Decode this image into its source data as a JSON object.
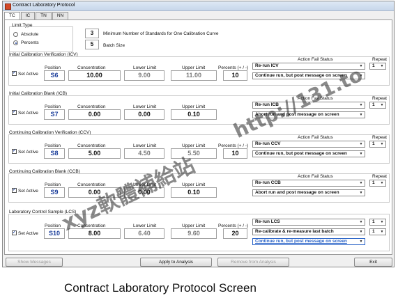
{
  "window": {
    "title": "Contract Laboratory Protocol"
  },
  "tabs": [
    "TC",
    "IC",
    "TN",
    "NN"
  ],
  "limit_type": {
    "label": "Limit Type",
    "options": [
      "Absolute",
      "Percents"
    ],
    "selected": "Percents"
  },
  "settings": [
    {
      "value": "3",
      "label": "Minimum Number of Standards for One Calibration Curve"
    },
    {
      "value": "5",
      "label": "Batch Size"
    }
  ],
  "col_labels": {
    "set_active": "Set Active",
    "position": "Position",
    "concentration": "Concentration",
    "lower": "Lower Limit",
    "upper": "Upper Limit",
    "percents": "Percents (+ / -)",
    "action": "Action Fail Status",
    "repeat": "Repeat"
  },
  "sections": [
    {
      "title": "Initial Calibration Verification (ICV)",
      "position": "S6",
      "concentration": "10.00",
      "lower": "9.00",
      "upper": "11.00",
      "percents": "10",
      "actions": [
        "Re-run ICV",
        "Continue run, but post message on screen"
      ],
      "repeat": "1"
    },
    {
      "title": "Initial Calibration Blank (ICB)",
      "position": "S7",
      "concentration": "0.00",
      "lower": "0.00",
      "upper": "0.10",
      "percents": "",
      "actions": [
        "Re-run ICB",
        "Abort run and post message on screen"
      ],
      "repeat": "1"
    },
    {
      "title": "Continuing Calibration Verification (CCV)",
      "position": "S8",
      "concentration": "5.00",
      "lower": "4.50",
      "upper": "5.50",
      "percents": "10",
      "actions": [
        "Re-run CCV",
        "Continue run, but post message on screen"
      ],
      "repeat": "1"
    },
    {
      "title": "Continuing Calibration Blank (CCB)",
      "position": "S9",
      "concentration": "0.00",
      "lower": "0.00",
      "upper": "0.10",
      "percents": "",
      "actions": [
        "Re-run CCB",
        "Abort run and post message on screen"
      ],
      "repeat": "1"
    },
    {
      "title": "Laboratory Control Sample (LCS)",
      "position": "S10",
      "concentration": "8.00",
      "lower": "6.40",
      "upper": "9.60",
      "percents": "20",
      "actions": [
        "Re-run LCS",
        "Re-calibrate & re-measure last batch",
        "Continue run, but post message on screen"
      ],
      "repeat": "1",
      "repeat2": "1"
    }
  ],
  "buttons": {
    "show_messages": "Show Messages",
    "apply": "Apply to Analysis",
    "remove": "Remove from Analysis",
    "exit": "Exit"
  },
  "caption": "Contract Laboratory Protocol Screen",
  "watermark": {
    "line1": "xyz軟體補給站",
    "line2": "http://131.to"
  },
  "colors": {
    "position_text": "#1a3d9a",
    "highlight": "#2a63c7",
    "accent_title": "#c6d6ea"
  }
}
